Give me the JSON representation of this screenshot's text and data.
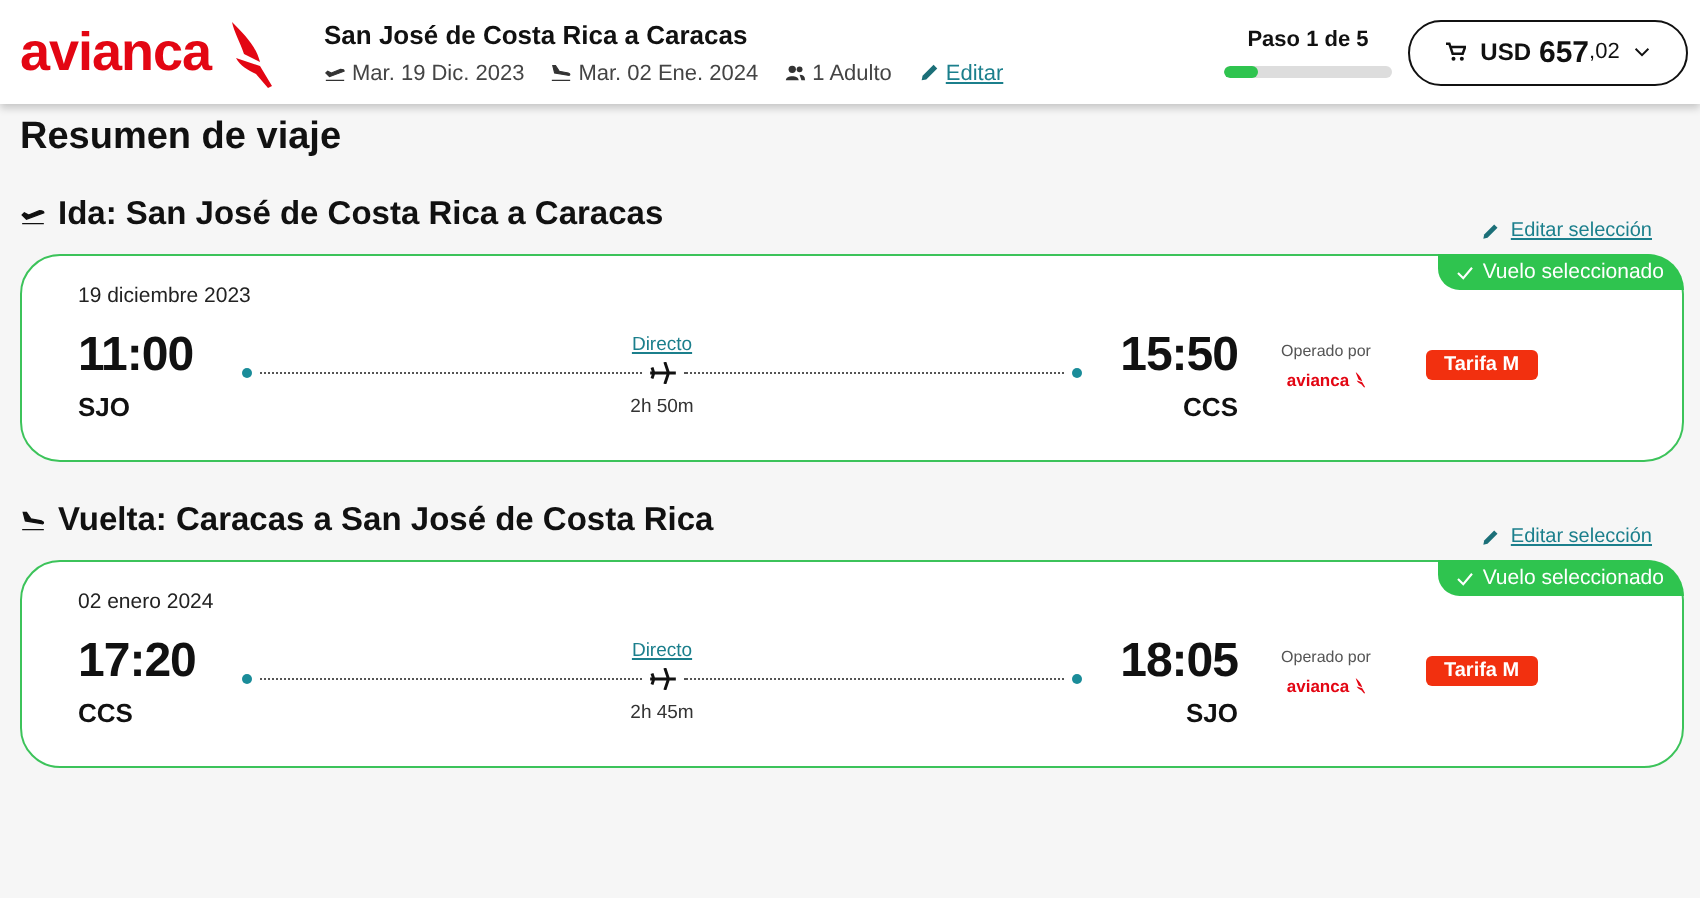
{
  "header": {
    "logo": "avianca",
    "route": "San José de Costa Rica a Caracas",
    "departure_date": "Mar. 19 Dic. 2023",
    "return_date": "Mar. 02 Ene. 2024",
    "passengers": "1 Adulto",
    "edit_link": "Editar",
    "step": {
      "label": "Paso 1 de 5",
      "level": 0.2
    },
    "cart": {
      "currency": "USD",
      "amount": "657",
      "cents": ",02"
    }
  },
  "title": "Resumen de viaje",
  "flights": [
    {
      "kind": "departure",
      "heading": "Ida: San José de Costa Rica a Caracas",
      "edit_link": "Editar selección",
      "badge": "Vuelo seleccionado",
      "date": "19 diciembre 2023",
      "depart_time": "11:00",
      "depart_code": "SJO",
      "stops": "Directo",
      "duration": "2h 50m",
      "arrive_time": "15:50",
      "arrive_code": "CCS",
      "operated_label": "Operado por",
      "operator": "avianca",
      "fare": "Tarifa M"
    },
    {
      "kind": "return",
      "heading": "Vuelta: Caracas a San José de Costa Rica",
      "edit_link": "Editar selección",
      "badge": "Vuelo seleccionado",
      "date": "02 enero 2024",
      "depart_time": "17:20",
      "depart_code": "CCS",
      "stops": "Directo",
      "duration": "2h 45m",
      "arrive_time": "18:05",
      "arrive_code": "SJO",
      "operated_label": "Operado por",
      "operator": "avianca",
      "fare": "Tarifa M"
    }
  ]
}
